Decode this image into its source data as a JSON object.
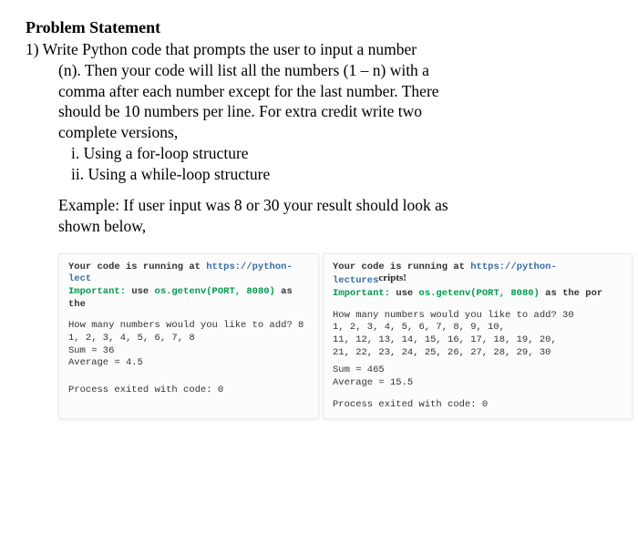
{
  "heading": "Problem Statement",
  "item_num": "1) ",
  "body_line1": "Write Python code that prompts the user to input a number",
  "body_line2": "(n). Then your code will list all the numbers (1 – n) with a",
  "body_line3": "comma after each number except for the last number. There",
  "body_line4": "should be 10 numbers per line. For extra credit write two",
  "body_line5": "complete versions,",
  "sub_i": "i. Using a for-loop structure",
  "sub_ii": "ii. Using a while-loop structure",
  "example_line1": "Example: If user input was 8 or 30 your result should look as",
  "example_line2": "shown below,",
  "left": {
    "run1a": "Your code is running at ",
    "run1b": "https://python-lect",
    "run2a": "Important:",
    "run2b": " use ",
    "run2c": "os.getenv(PORT, 8080)",
    "run2d": " as the",
    "prompt": "How many numbers would you like to add? 8",
    "row1": "1, 2, 3, 4, 5, 6, 7, 8",
    "sum": "Sum =  36",
    "avg": "Average =  4.5",
    "exit": "Process exited with code: 0"
  },
  "right": {
    "run1a": "Your code is running at ",
    "run1b": "https://python-lectures",
    "run2a": "Important:",
    "run2b": " use ",
    "run2c": "os.getenv(PORT, 8080)",
    "run2d": " as the por",
    "cripts": "cripts!",
    "prompt": "How many numbers would you like to add? 30",
    "row1": "1, 2, 3, 4, 5, 6, 7, 8, 9, 10,",
    "row2": "11, 12, 13, 14, 15, 16, 17, 18, 19, 20,",
    "row3": "21, 22, 23, 24, 25, 26, 27, 28, 29, 30",
    "sum": "Sum =  465",
    "avg": "Average =  15.5",
    "exit": "Process exited with code: 0"
  }
}
